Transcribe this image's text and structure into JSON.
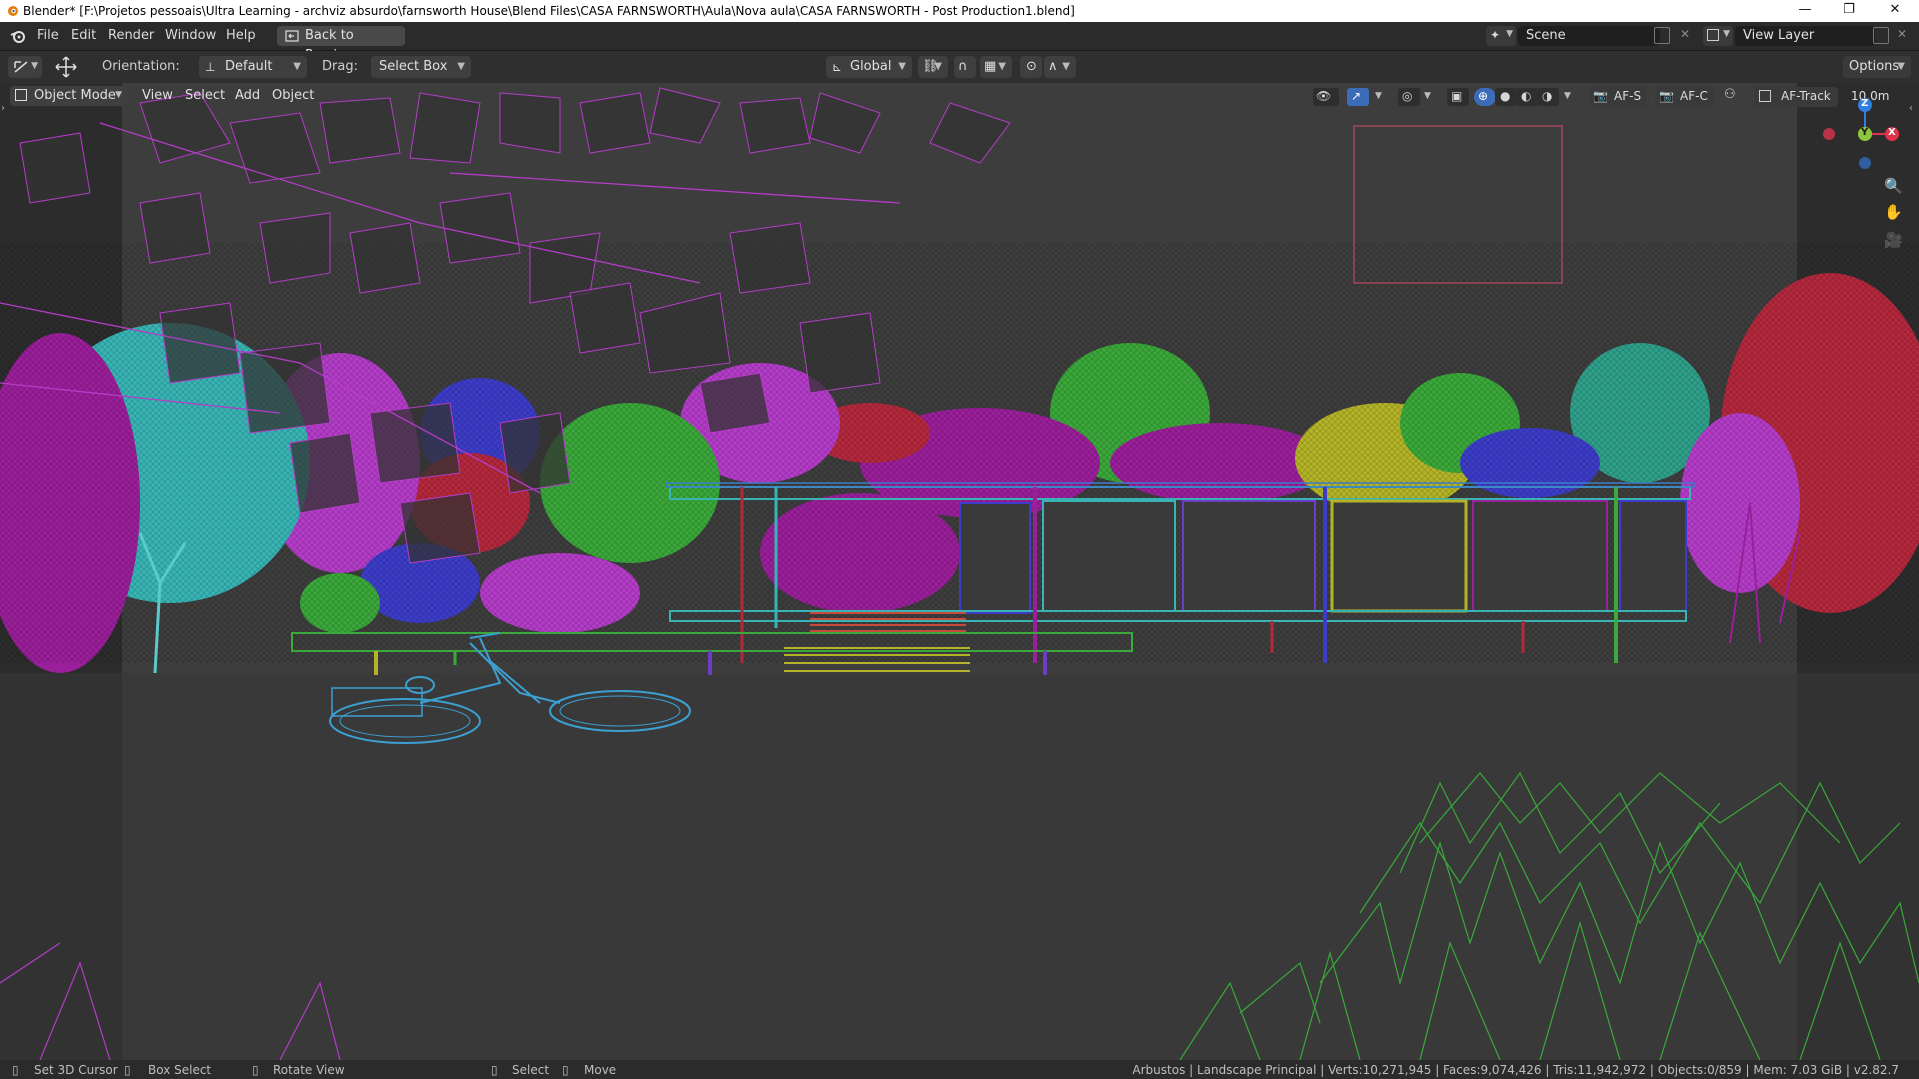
{
  "titlebar": {
    "title": "Blender* [F:\\Projetos pessoais\\Ultra Learning - archviz absurdo\\farnsworth House\\Blend Files\\CASA FARNSWORTH\\Aula\\Nova aula\\CASA FARNSWORTH - Post Production1.blend]",
    "minimize": "—",
    "maximize": "❐",
    "close": "✕"
  },
  "menu": {
    "items": [
      "File",
      "Edit",
      "Render",
      "Window",
      "Help"
    ],
    "back_button": "Back to Previous",
    "scene_label": "Scene",
    "viewlayer_label": "View Layer"
  },
  "toolbar": {
    "orientation_label": "Orientation:",
    "orientation_value": "Default",
    "drag_label": "Drag:",
    "drag_value": "Select Box",
    "transform_orientation": "Global",
    "options_label": "Options"
  },
  "viewport_header": {
    "mode": "Object Mode",
    "menus": [
      "View",
      "Select",
      "Add",
      "Object"
    ],
    "af_s": "AF-S",
    "af_c": "AF-C",
    "af_track": "AF-Track",
    "distance": "10.0m"
  },
  "gizmo": {
    "z": "Z",
    "y": "Y",
    "x": "X"
  },
  "statusbar": {
    "set_cursor": "Set 3D Cursor",
    "box_select": "Box Select",
    "rotate_view": "Rotate View",
    "select": "Select",
    "move": "Move",
    "info": "Arbustos | Landscape Principal | Verts:10,271,945 | Faces:9,074,426 | Tris:11,942,972 | Objects:0/859 | Mem: 7.03 GiB | v2.82.7"
  },
  "colors": {
    "magenta": "#b43cc8",
    "green": "#3aa83a",
    "cyan": "#38b4b4",
    "crimson": "#b4283c",
    "blue": "#3c3cc8",
    "olive": "#b4b428",
    "bike": "#3ca0d2"
  }
}
